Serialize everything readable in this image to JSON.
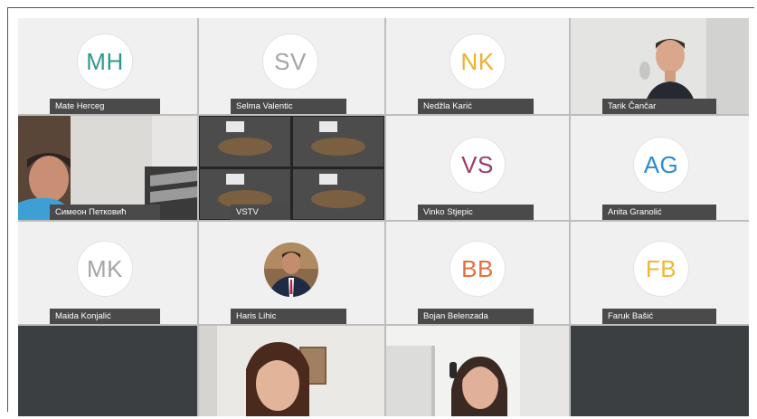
{
  "participants": [
    {
      "name": "Mate Herceg",
      "initials": "MH",
      "color": "#2e9a8a"
    },
    {
      "name": "Selma Valentic",
      "initials": "SV",
      "color": "#a5a5a5"
    },
    {
      "name": "Nedžla Karić",
      "initials": "NK",
      "color": "#efb02c"
    },
    {
      "name": "Tarik Čančar"
    },
    {
      "name": "Симеон Петковић"
    },
    {
      "name": "VSTV"
    },
    {
      "name": "Vinko Stjepic",
      "initials": "VS",
      "color": "#9b3b6c"
    },
    {
      "name": "Anita Granolić",
      "initials": "AG",
      "color": "#2b8ad6"
    },
    {
      "name": "Maida Konjalić",
      "initials": "MK",
      "color": "#a5a5a5"
    },
    {
      "name": "Haris Lihic"
    },
    {
      "name": "Bojan Belenzada",
      "initials": "BB",
      "color": "#e56f3a"
    },
    {
      "name": "Faruk Bašić",
      "initials": "FB",
      "color": "#f0b733"
    }
  ]
}
